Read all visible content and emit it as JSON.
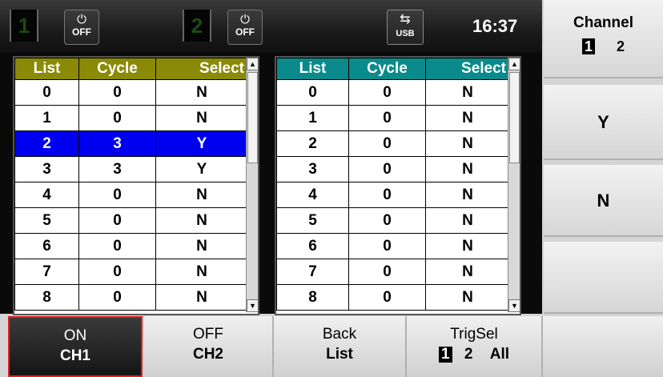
{
  "status_bar": {
    "ch1_number": "1",
    "ch1_power_label": "OFF",
    "ch2_number": "2",
    "ch2_power_label": "OFF",
    "usb_label": "USB",
    "time": "16:37"
  },
  "table_left": {
    "headers": [
      "List",
      "Cycle",
      "Select"
    ],
    "rows": [
      [
        "0",
        "0",
        "N"
      ],
      [
        "1",
        "0",
        "N"
      ],
      [
        "2",
        "3",
        "Y"
      ],
      [
        "3",
        "3",
        "Y"
      ],
      [
        "4",
        "0",
        "N"
      ],
      [
        "5",
        "0",
        "N"
      ],
      [
        "6",
        "0",
        "N"
      ],
      [
        "7",
        "0",
        "N"
      ],
      [
        "8",
        "0",
        "N"
      ]
    ],
    "highlighted_row": 2
  },
  "table_right": {
    "headers": [
      "List",
      "Cycle",
      "Select"
    ],
    "rows": [
      [
        "0",
        "0",
        "N"
      ],
      [
        "1",
        "0",
        "N"
      ],
      [
        "2",
        "0",
        "N"
      ],
      [
        "3",
        "0",
        "N"
      ],
      [
        "4",
        "0",
        "N"
      ],
      [
        "5",
        "0",
        "N"
      ],
      [
        "6",
        "0",
        "N"
      ],
      [
        "7",
        "0",
        "N"
      ],
      [
        "8",
        "0",
        "N"
      ]
    ]
  },
  "side_menu": {
    "channel_title": "Channel",
    "channel_opt1": "1",
    "channel_opt2": "2",
    "yes_label": "Y",
    "no_label": "N"
  },
  "softkeys": {
    "on_l1": "ON",
    "on_l2": "CH1",
    "off_l1": "OFF",
    "off_l2": "CH2",
    "back_l1": "Back",
    "back_l2": "List",
    "trig_l1": "TrigSel",
    "trig_opt1": "1",
    "trig_opt2": "2",
    "trig_opt3": "All"
  },
  "colors": {
    "left_header": "#8a8a07",
    "right_header": "#0a8a8a",
    "highlight": "#0000f0",
    "active_border": "#e02020"
  }
}
